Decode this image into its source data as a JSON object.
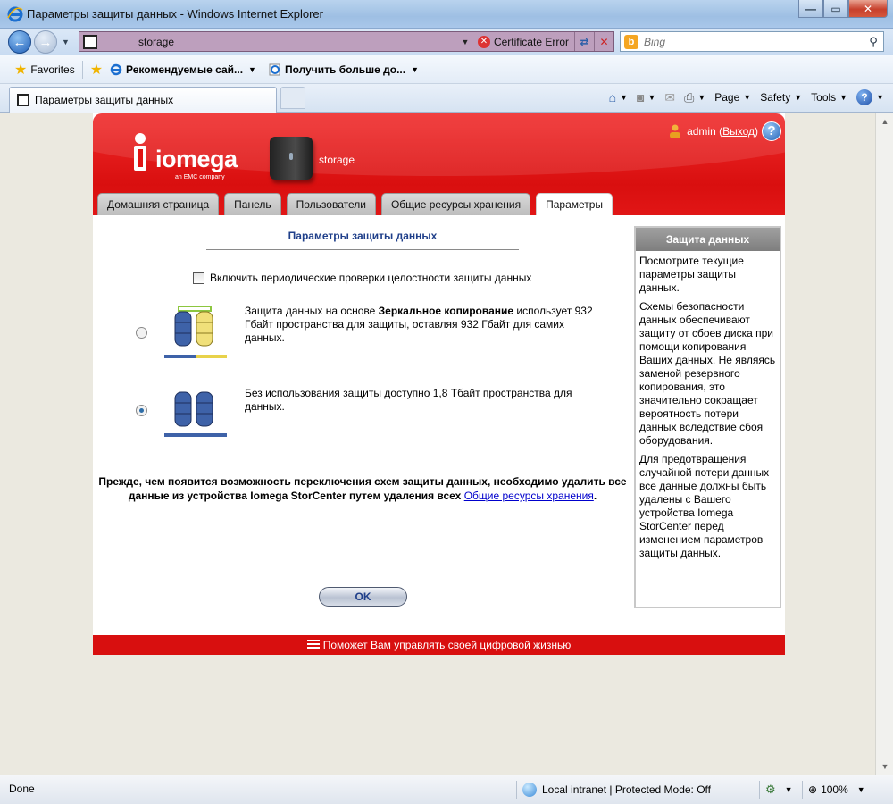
{
  "window": {
    "title": "Параметры защиты данных - Windows Internet Explorer",
    "min_icon": "minimize-icon",
    "max_icon": "maximize-icon",
    "close_icon": "close-icon"
  },
  "address_bar": {
    "url": "storage",
    "certificate_error": "Certificate Error"
  },
  "search": {
    "placeholder": "Bing"
  },
  "favorites_bar": {
    "favorites_label": "Favorites",
    "links": [
      "Рекомендуемые сай...",
      "Получить больше до..."
    ]
  },
  "tabs": [
    {
      "label": "Параметры защиты данных"
    }
  ],
  "command_bar": {
    "page": "Page",
    "safety": "Safety",
    "tools": "Tools"
  },
  "app": {
    "device_name": "storage",
    "user": {
      "name": "admin",
      "logout": "Выход"
    },
    "logo": {
      "word": "iomega",
      "tagline": "an EMC company"
    },
    "nav_tabs": [
      "Домашняя страница",
      "Панель",
      "Пользователи",
      "Общие ресурсы хранения",
      "Параметры"
    ],
    "active_tab": "Параметры",
    "page_title": "Параметры защиты данных",
    "integrity_check_label": "Включить периодические проверки целостности защиты данных",
    "integrity_check_checked": false,
    "scheme_mirror": {
      "before": "Защита данных на основе ",
      "bold": "Зеркальное копирование",
      "after": " использует 932 Гбайт пространства для защиты, оставляя 932 Гбайт для самих данных.",
      "selected": false
    },
    "scheme_none": {
      "text": "Без использования защиты доступно 1,8 Тбайт пространства для данных.",
      "selected": true
    },
    "warning": {
      "text": "Прежде, чем появится возможность переключения схем защиты данных, необходимо удалить все данные из устройства Iomega StorCenter путем удаления всех",
      "link": "Общие ресурсы хранения",
      "end": "."
    },
    "ok_button": "OK",
    "help_panel": {
      "title": "Защита данных",
      "paragraphs": [
        "Посмотрите текущие параметры защиты данных.",
        "Схемы безопасности данных обеспечивают защиту от сбоев диска при помощи копирования Ваших данных. Не являясь заменой резервного копирования, это значительно сокращает вероятность потери данных вследствие сбоя оборудования.",
        "Для предотвращения случайной потери данных все данные должны быть удалены с Вашего устройства Iomega StorCenter перед изменением параметров защиты данных."
      ]
    },
    "footer": "Поможет Вам управлять своей цифровой жизнью"
  },
  "status_bar": {
    "status": "Done",
    "zone": "Local intranet | Protected Mode: Off",
    "zoom": "100%"
  }
}
